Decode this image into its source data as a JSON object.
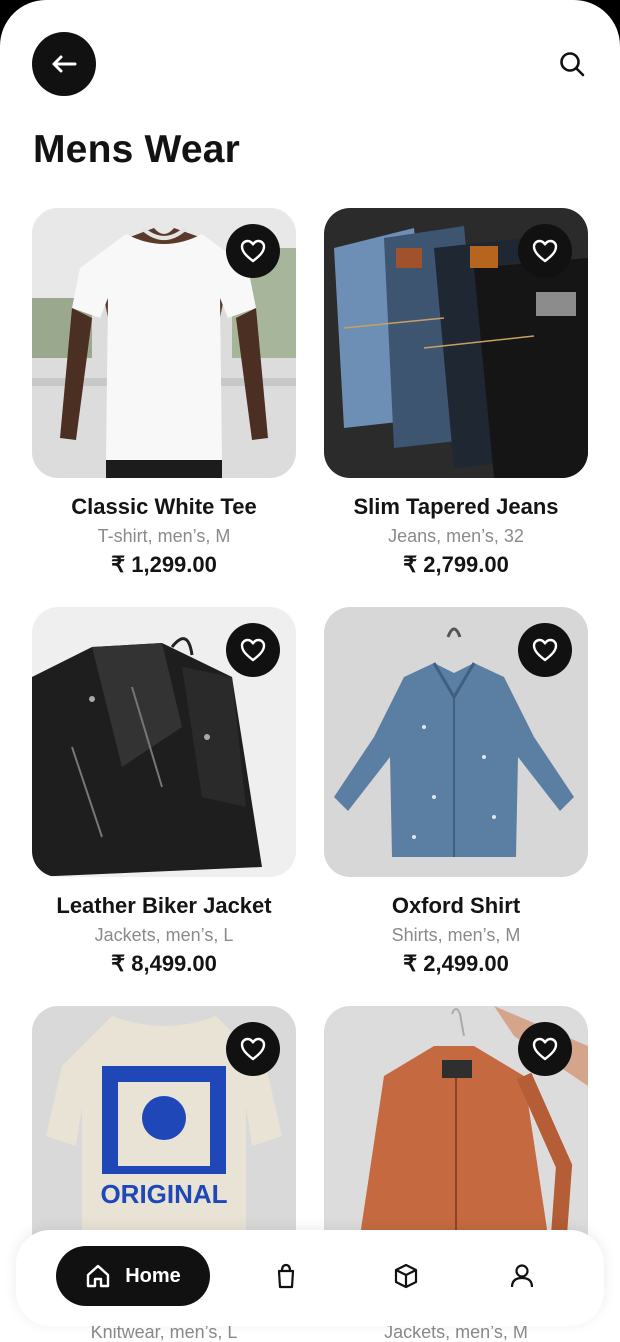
{
  "header": {
    "back_icon": "arrow-left-icon",
    "search_icon": "search-icon",
    "title": "Mens Wear"
  },
  "products": [
    {
      "name": "Classic White Tee",
      "meta": "T-shirt, men’s, M",
      "price": "₹ 1,299.00",
      "favorite_icon": "heart-outline-icon"
    },
    {
      "name": "Slim Tapered Jeans",
      "meta": "Jeans, men’s, 32",
      "price": "₹ 2,799.00",
      "favorite_icon": "heart-outline-icon"
    },
    {
      "name": "Leather Biker Jacket",
      "meta": "Jackets, men’s, L",
      "price": "₹ 8,499.00",
      "favorite_icon": "heart-outline-icon"
    },
    {
      "name": "Oxford Shirt",
      "meta": "Shirts, men’s, M",
      "price": "₹ 2,499.00",
      "favorite_icon": "heart-outline-icon"
    },
    {
      "name": "",
      "meta": "Knitwear, men’s, L",
      "price": "",
      "favorite_icon": "heart-outline-icon",
      "graphic_text": "ORIGINAL"
    },
    {
      "name": "",
      "meta": "Jackets, men’s, M",
      "price": "",
      "favorite_icon": "heart-outline-icon"
    }
  ],
  "bottom_nav": {
    "active": "Home",
    "items": [
      {
        "label": "Home",
        "icon": "home-icon"
      },
      {
        "label": "",
        "icon": "shopping-bag-icon"
      },
      {
        "label": "",
        "icon": "box-icon"
      },
      {
        "label": "",
        "icon": "user-icon"
      }
    ]
  },
  "colors": {
    "accent": "#111111",
    "background": "#ffffff",
    "muted_text": "#8a8a8a"
  }
}
